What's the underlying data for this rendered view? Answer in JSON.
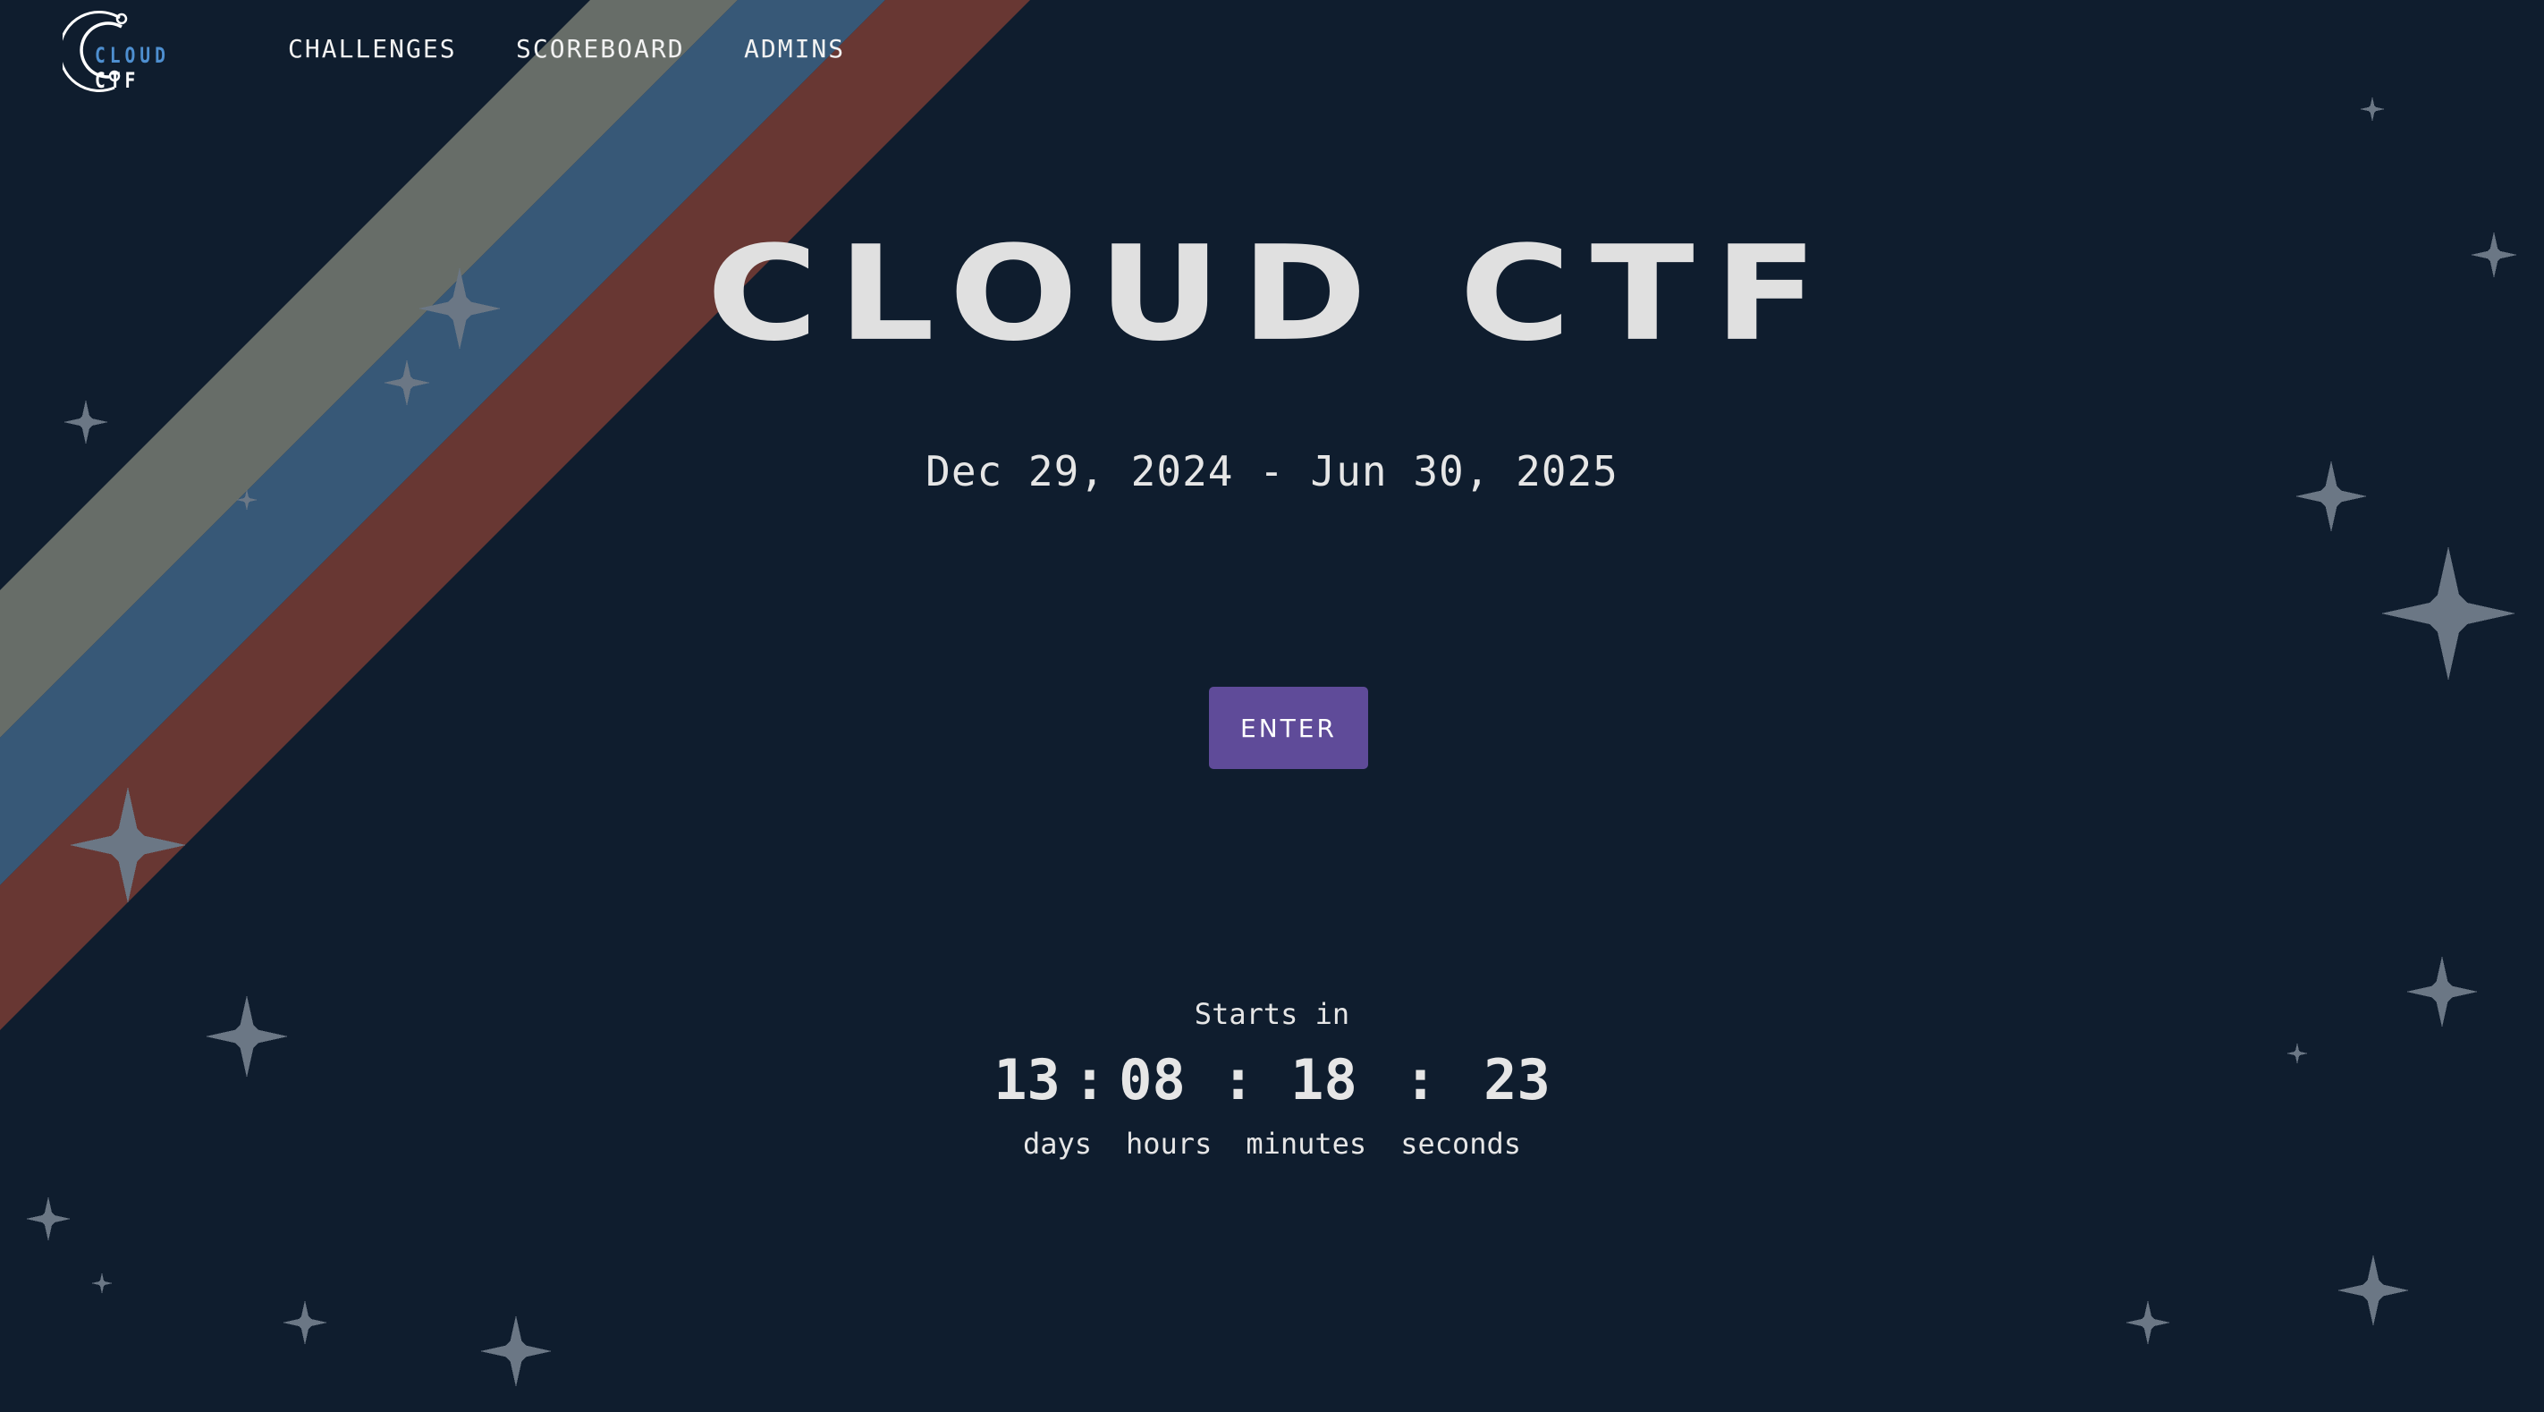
{
  "nav": {
    "logo": {
      "word1": "CLOUD",
      "word2": "CTF"
    },
    "links": [
      {
        "label": "CHALLENGES"
      },
      {
        "label": "SCOREBOARD"
      },
      {
        "label": "ADMINS"
      }
    ]
  },
  "hero": {
    "title": "CLOUD CTF",
    "dates": "Dec 29, 2024 - Jun 30, 2025",
    "enter_label": "ENTER"
  },
  "countdown": {
    "label": "Starts in",
    "days": "13",
    "hours": "08",
    "minutes": "18",
    "seconds": "23",
    "units": {
      "days": "days",
      "hours": "hours",
      "minutes": "minutes",
      "seconds": "seconds"
    }
  },
  "theme": {
    "background": "#0f1d2e",
    "stripe_colors": [
      "#676d68",
      "#375877",
      "#683733"
    ],
    "star_color": "#6b7785",
    "button_color": "#5f4b99",
    "text_color": "#e4e4e4",
    "logo_accent": "#4e8fd0"
  }
}
